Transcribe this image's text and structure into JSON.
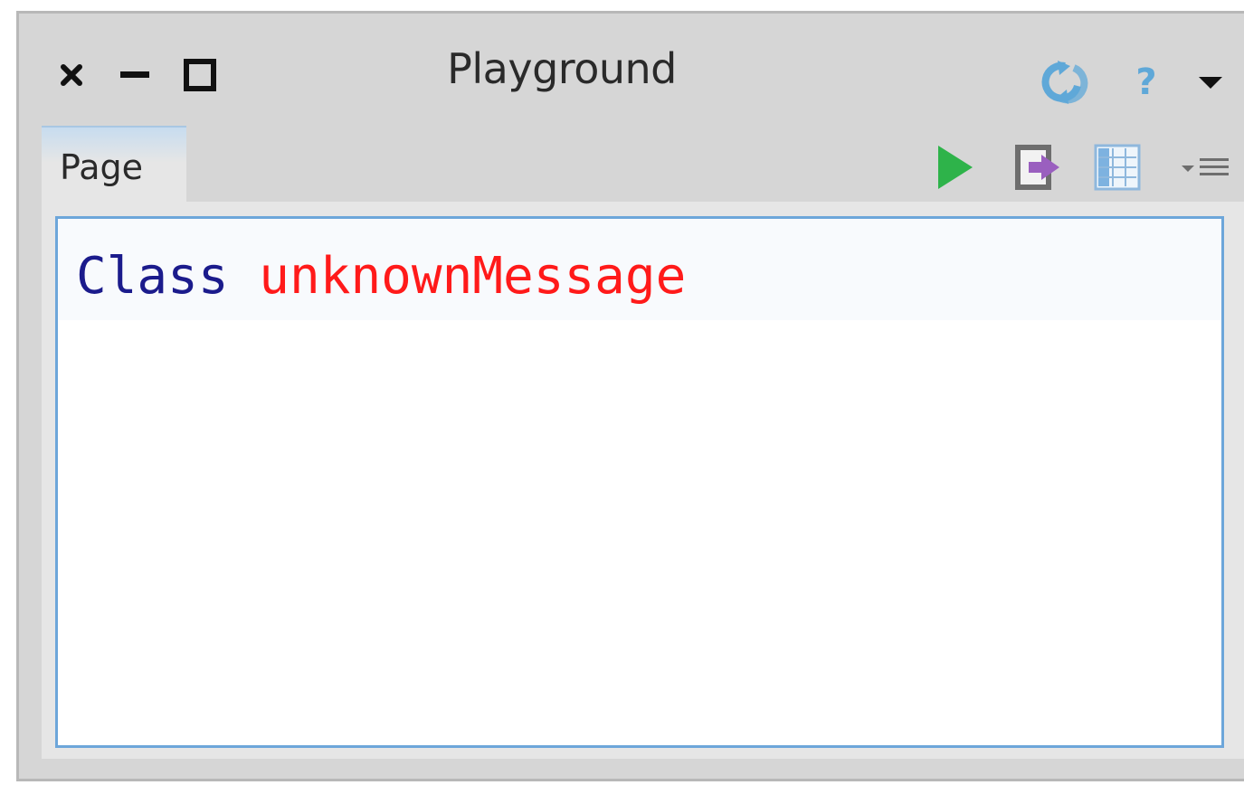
{
  "window": {
    "title": "Playground",
    "controls": {
      "close_icon": "close-icon",
      "minimize_icon": "minimize-icon",
      "maximize_icon": "maximize-icon"
    },
    "right_controls": [
      "refresh-icon",
      "help-icon",
      "menu-dropdown-icon"
    ],
    "help_label": "?"
  },
  "tabs": [
    {
      "label": "Page",
      "selected": true
    }
  ],
  "toolbar": {
    "icons": [
      "run-icon",
      "export-icon",
      "inspect-columns-icon",
      "more-menu-icon"
    ]
  },
  "editor": {
    "tokens": [
      {
        "text": "Class",
        "role": "class",
        "color": "#1b1b8c"
      },
      {
        "text": " ",
        "role": "space",
        "color": "#000000"
      },
      {
        "text": "unknownMessage",
        "role": "unknown-message",
        "color": "#ff1a1a"
      }
    ]
  },
  "colors": {
    "window_bg": "#d6d6d6",
    "editor_border": "#6da6da",
    "run_green": "#2eb34a",
    "accent_blue": "#5fa8d8",
    "export_purple": "#9a5fbf"
  }
}
